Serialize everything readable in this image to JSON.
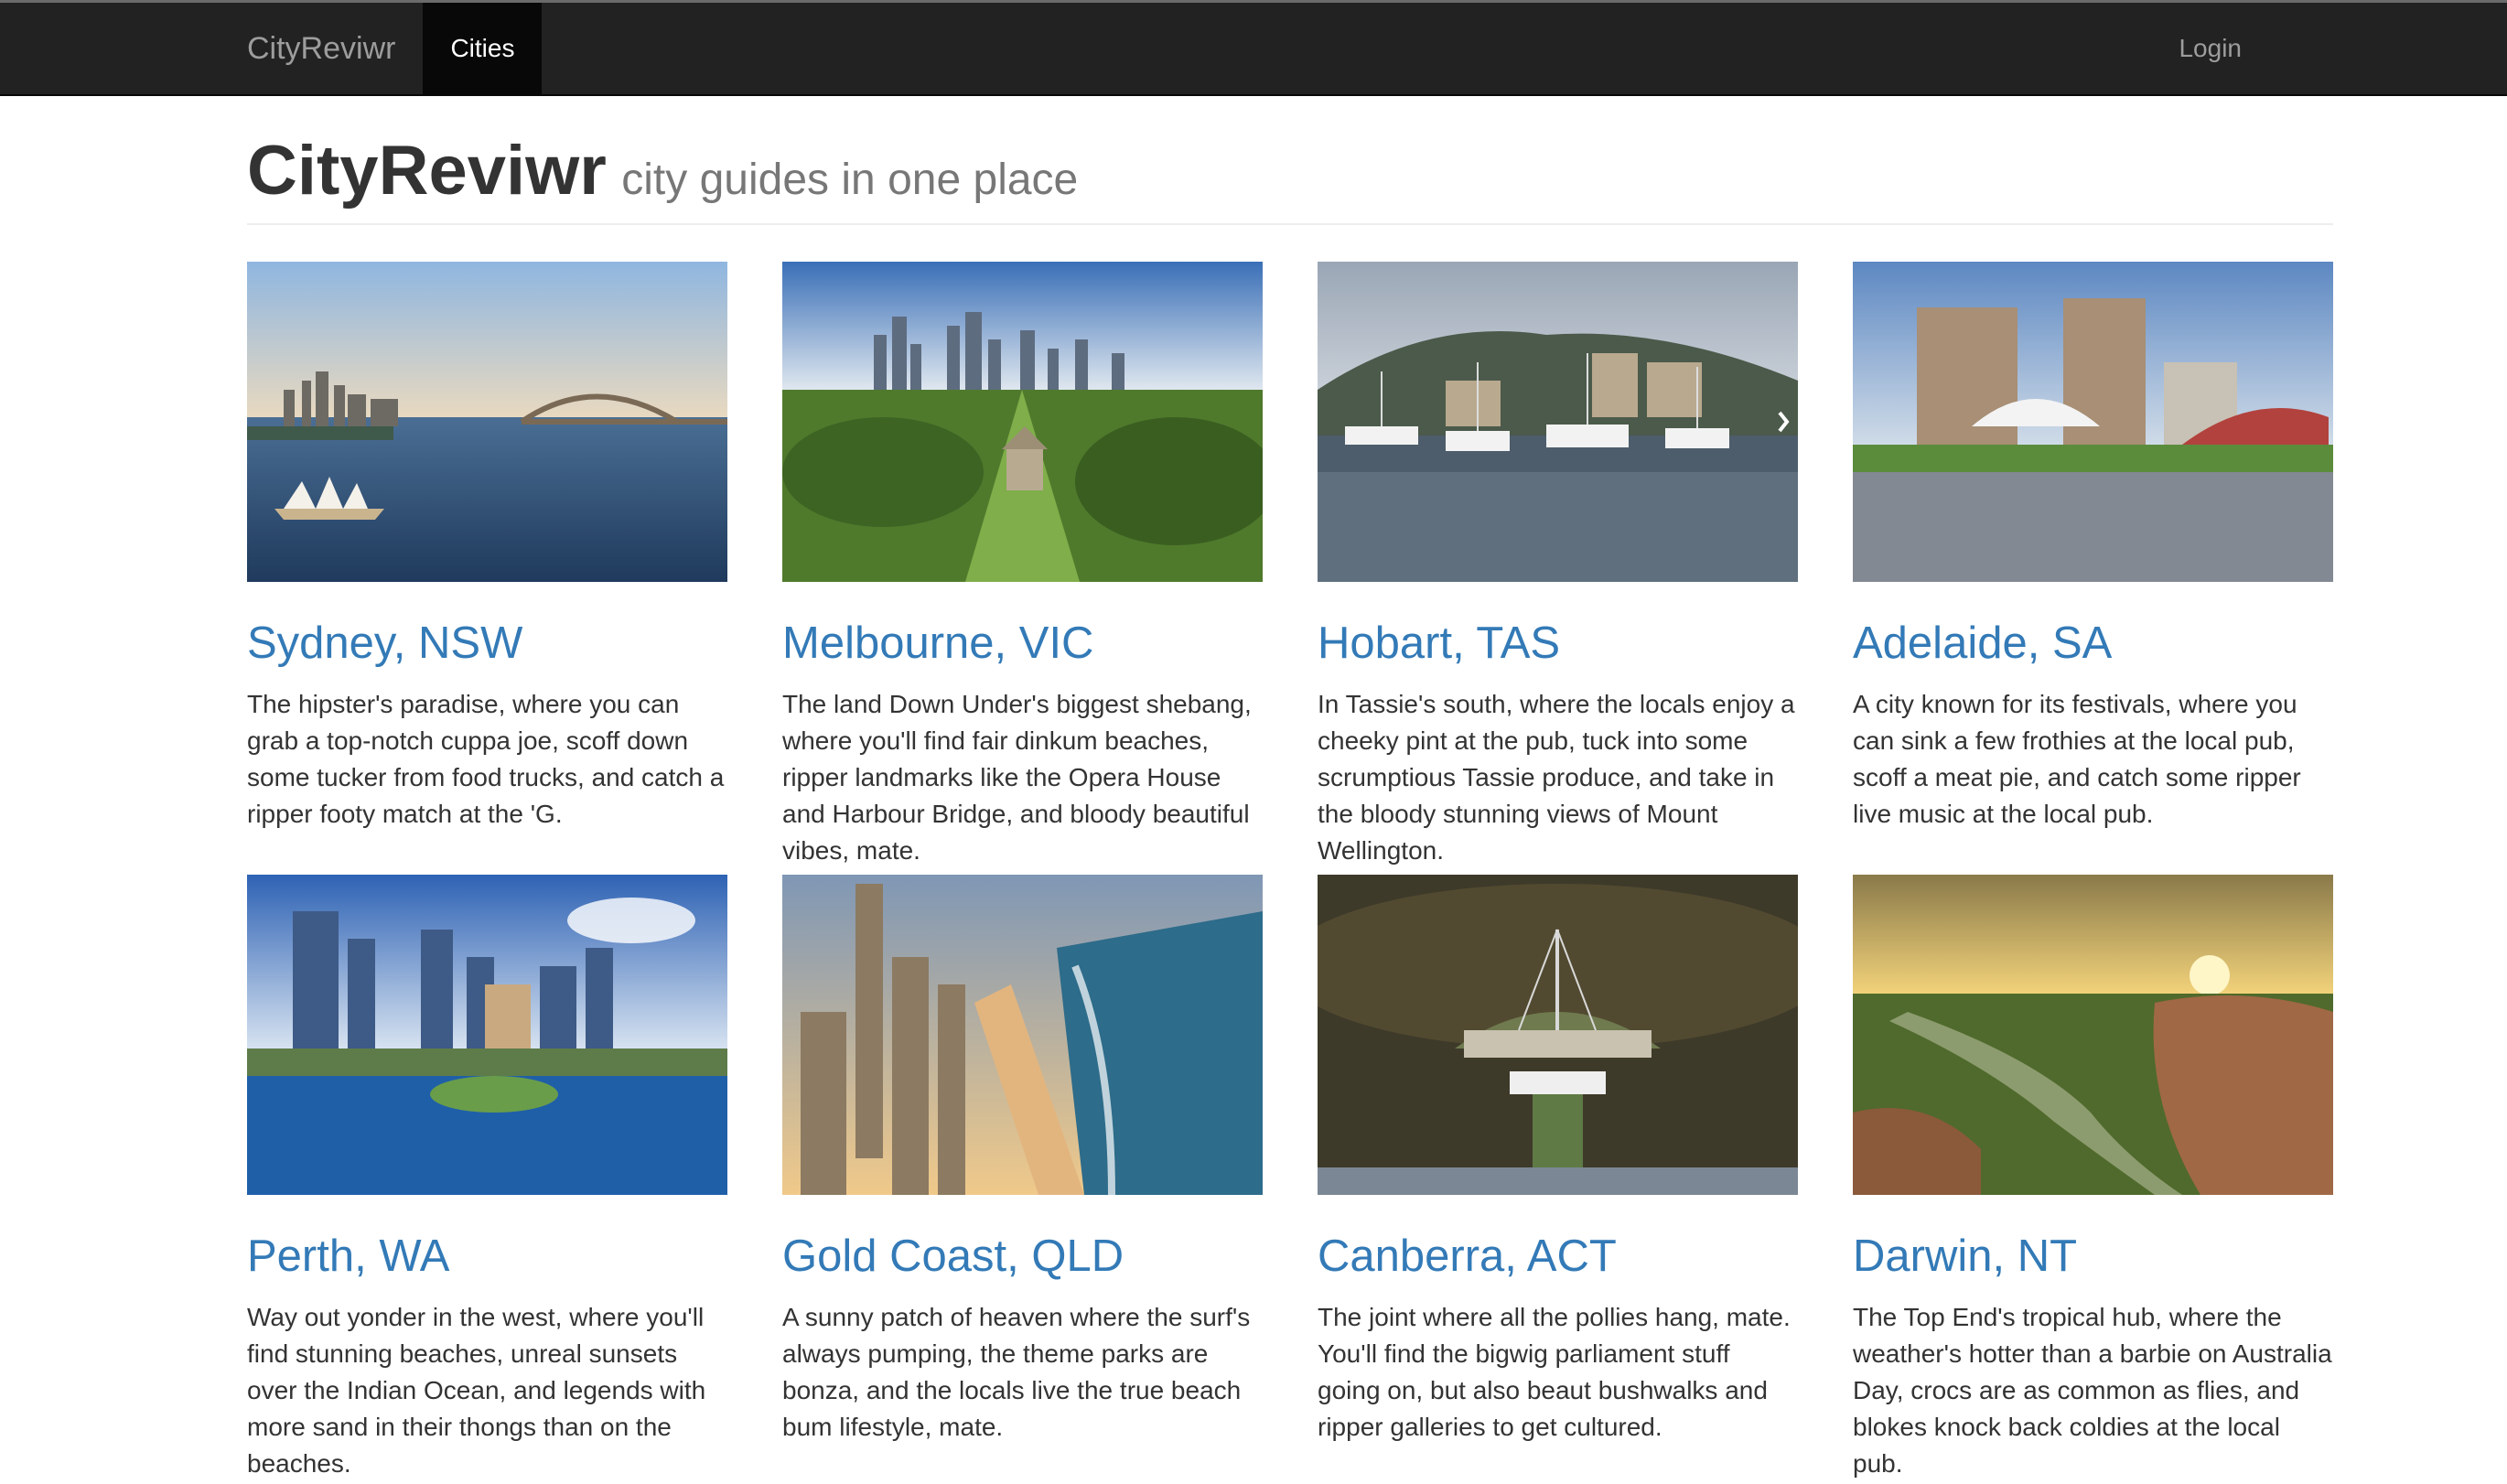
{
  "navbar": {
    "brand": "CityReviwr",
    "items": [
      {
        "label": "Cities",
        "active": true
      }
    ],
    "login_label": "Login"
  },
  "header": {
    "title": "CityReviwr",
    "subtitle": "city guides in one place"
  },
  "colors": {
    "navbar_bg": "#222222",
    "link": "#337ab7",
    "muted": "#777777"
  },
  "cities": [
    {
      "name": "Sydney, NSW",
      "description": "The hipster's paradise, where you can grab a top-notch cuppa joe, scoff down some tucker from food trucks, and catch a ripper footy match at the 'G."
    },
    {
      "name": "Melbourne, VIC",
      "description": "The land Down Under's biggest shebang, where you'll find fair dinkum beaches, ripper landmarks like the Opera House and Harbour Bridge, and bloody beautiful vibes, mate."
    },
    {
      "name": "Hobart, TAS",
      "description": "In Tassie's south, where the locals enjoy a cheeky pint at the pub, tuck into some scrumptious Tassie produce, and take in the bloody stunning views of Mount Wellington."
    },
    {
      "name": "Adelaide, SA",
      "description": "A city known for its festivals, where you can sink a few frothies at the local pub, scoff a meat pie, and catch some ripper live music at the local pub."
    },
    {
      "name": "Perth, WA",
      "description": "Way out yonder in the west, where you'll find stunning beaches, unreal sunsets over the Indian Ocean, and legends with more sand in their thongs than on the beaches."
    },
    {
      "name": "Gold Coast, QLD",
      "description": "A sunny patch of heaven where the surf's always pumping, the theme parks are bonza, and the locals live the true beach bum lifestyle, mate."
    },
    {
      "name": "Canberra, ACT",
      "description": "The joint where all the pollies hang, mate. You'll find the bigwig parliament stuff going on, but also beaut bushwalks and ripper galleries to get cultured."
    },
    {
      "name": "Darwin, NT",
      "description": "The Top End's tropical hub, where the weather's hotter than a barbie on Australia Day, crocs are as common as flies, and blokes knock back coldies at the local pub."
    }
  ]
}
